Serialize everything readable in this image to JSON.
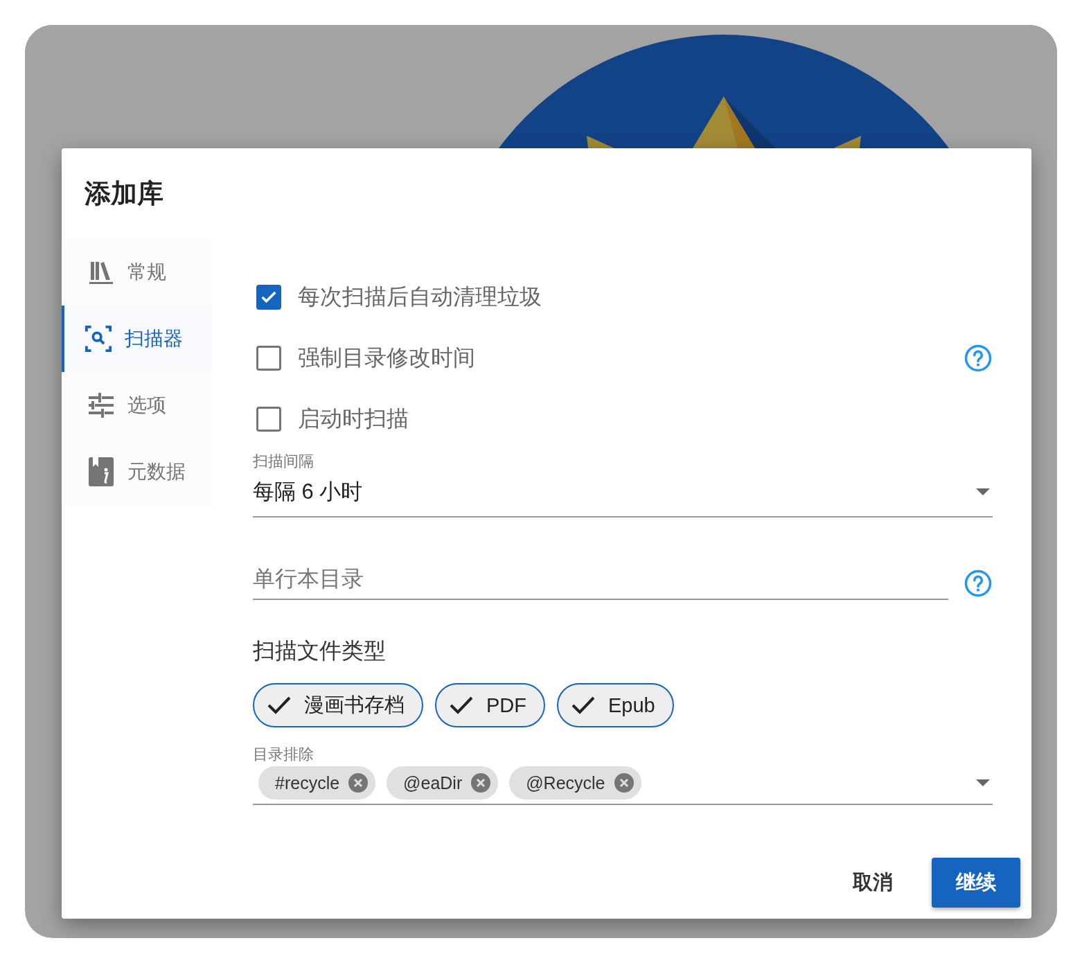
{
  "dialog": {
    "title": "添加库",
    "nav": [
      {
        "label": "常规",
        "kind": "books",
        "selected": false
      },
      {
        "label": "扫描器",
        "kind": "scanner",
        "selected": true
      },
      {
        "label": "选项",
        "kind": "tune",
        "selected": false
      },
      {
        "label": "元数据",
        "kind": "info",
        "selected": false
      }
    ],
    "options": [
      {
        "label": "每次扫描后自动清理垃圾",
        "checked": true,
        "help": false
      },
      {
        "label": "强制目录修改时间",
        "checked": false,
        "help": true
      },
      {
        "label": "启动时扫描",
        "checked": false,
        "help": false
      }
    ],
    "scan_interval": {
      "label": "扫描间隔",
      "value": "每隔 6 小时"
    },
    "series_dir": {
      "placeholder": "单行本目录",
      "help": true
    },
    "file_types": {
      "heading": "扫描文件类型",
      "chips": [
        {
          "label": "漫画书存档",
          "selected": true
        },
        {
          "label": "PDF",
          "selected": true
        },
        {
          "label": "Epub",
          "selected": true
        }
      ]
    },
    "exclude": {
      "label": "目录排除",
      "tags": [
        "#recycle",
        "@eaDir",
        "@Recycle"
      ]
    },
    "buttons": [
      {
        "label": "取消",
        "kind": "text"
      },
      {
        "label": "继续",
        "kind": "primary"
      }
    ]
  }
}
